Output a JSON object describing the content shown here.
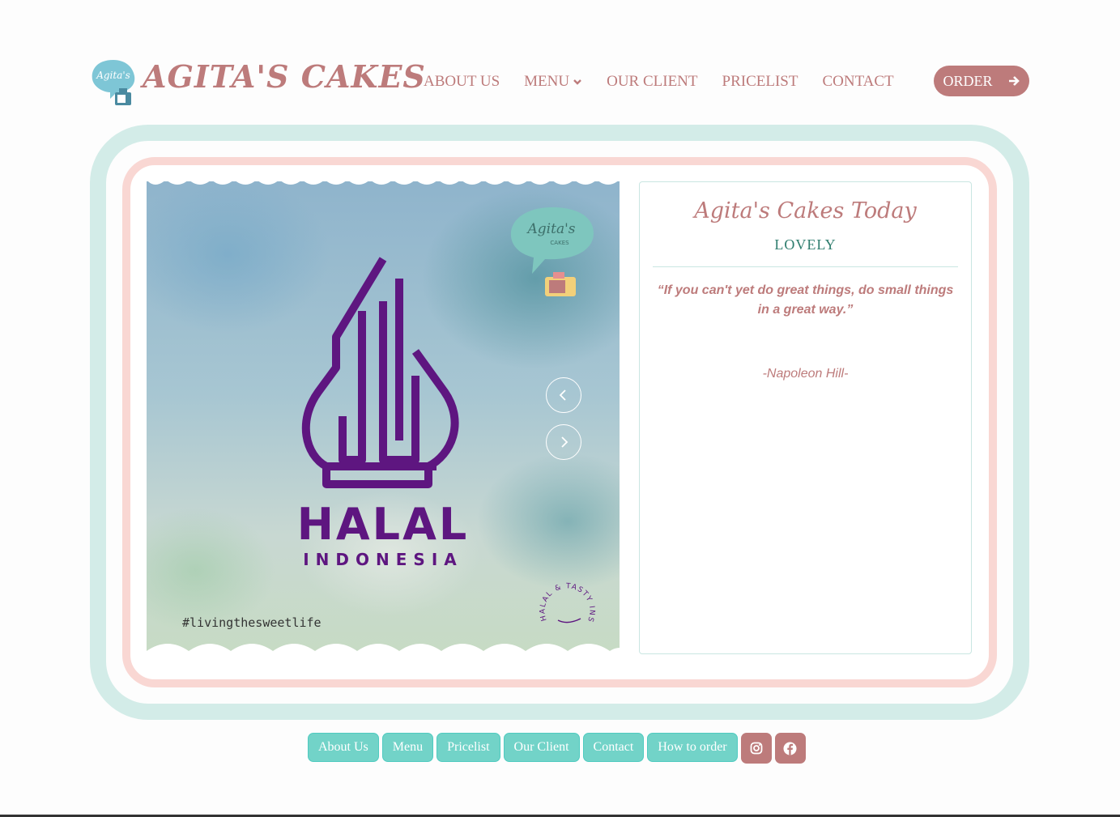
{
  "header": {
    "brand": "AGITA'S CAKES",
    "nav": [
      {
        "label": "ABOUT US"
      },
      {
        "label": "MENU"
      },
      {
        "label": "OUR CLIENT"
      },
      {
        "label": "PRICELIST"
      },
      {
        "label": "CONTACT"
      }
    ],
    "order_label": "ORDER"
  },
  "slide": {
    "badge_text": "Agita's",
    "badge_sub": "CAKES",
    "halal_main": "HALAL",
    "halal_sub": "INDONESIA",
    "hashtag": "#livingthesweetlife",
    "stamp_text": "HALAL & TASTY INSIDE"
  },
  "card": {
    "title": "Agita's Cakes Today",
    "subtitle": "LOVELY",
    "quote": "“If you can't yet do great things, do small things in a great way.”",
    "author": "-Napoleon Hill-"
  },
  "footer": {
    "buttons": [
      {
        "label": "About Us"
      },
      {
        "label": "Menu"
      },
      {
        "label": "Pricelist"
      },
      {
        "label": "Our Client"
      },
      {
        "label": "Contact"
      },
      {
        "label": "How to order"
      }
    ],
    "social": [
      "instagram-icon",
      "facebook-icon"
    ]
  },
  "colors": {
    "brand_rose": "#bd7b7b",
    "mint": "#72d3c8",
    "frame_mint": "#d3ece8",
    "frame_pink": "#f9d7d3",
    "halal_purple": "#5e1680"
  }
}
